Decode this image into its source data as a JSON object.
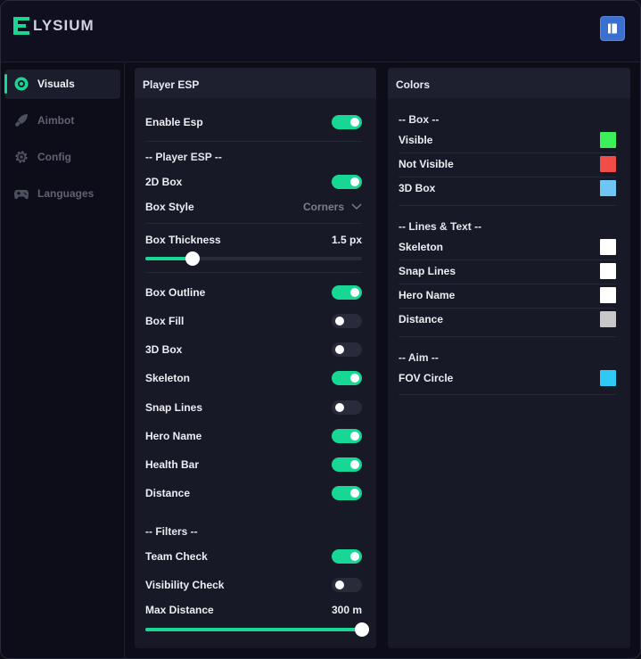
{
  "app": {
    "name": "LYSIUM",
    "logo_letter": "E"
  },
  "header": {
    "action_icon": "book-icon"
  },
  "sidebar": {
    "items": [
      {
        "label": "Visuals",
        "icon": "eye-target-icon",
        "active": true
      },
      {
        "label": "Aimbot",
        "icon": "rocket-icon",
        "active": false
      },
      {
        "label": "Config",
        "icon": "gear-icon",
        "active": false
      },
      {
        "label": "Languages",
        "icon": "gamepad-icon",
        "active": false
      }
    ]
  },
  "player_esp": {
    "title": "Player ESP",
    "enable_esp": {
      "label": "Enable Esp",
      "on": true
    },
    "section_player": "-- Player ESP --",
    "box_2d": {
      "label": "2D Box",
      "on": true
    },
    "box_style": {
      "label": "Box Style",
      "value": "Corners"
    },
    "box_thickness": {
      "label": "Box Thickness",
      "value_text": "1.5 px",
      "fraction": 0.22
    },
    "toggles": [
      {
        "label": "Box Outline",
        "on": true
      },
      {
        "label": "Box Fill",
        "on": false
      },
      {
        "label": "3D Box",
        "on": false
      },
      {
        "label": "Skeleton",
        "on": true
      },
      {
        "label": "Snap Lines",
        "on": false
      },
      {
        "label": "Hero Name",
        "on": true
      },
      {
        "label": "Health Bar",
        "on": true
      },
      {
        "label": "Distance",
        "on": true
      }
    ],
    "section_filters": "-- Filters --",
    "team_check": {
      "label": "Team Check",
      "on": true
    },
    "visibility_check": {
      "label": "Visibility Check",
      "on": false
    },
    "max_distance": {
      "label": "Max Distance",
      "value_text": "300 m",
      "fraction": 1.0
    }
  },
  "colors": {
    "title": "Colors",
    "section_box": "-- Box --",
    "box_items": [
      {
        "label": "Visible",
        "color": "#3cf05a"
      },
      {
        "label": "Not Visible",
        "color": "#f04c48"
      },
      {
        "label": "3D Box",
        "color": "#6ec6f5"
      }
    ],
    "section_lines": "-- Lines & Text --",
    "line_items": [
      {
        "label": "Skeleton",
        "color": "#ffffff"
      },
      {
        "label": "Snap Lines",
        "color": "#ffffff"
      },
      {
        "label": "Hero Name",
        "color": "#ffffff"
      },
      {
        "label": "Distance",
        "color": "#c8c8c8"
      }
    ],
    "section_aim": "-- Aim --",
    "aim_items": [
      {
        "label": "FOV Circle",
        "color": "#2ec9f5"
      }
    ]
  },
  "accent": "#18d694"
}
